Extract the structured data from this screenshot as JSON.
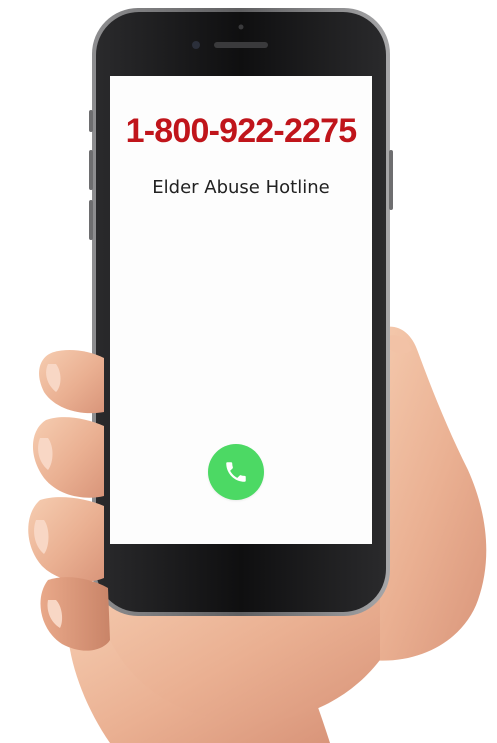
{
  "dialer": {
    "phone_number": "1-800-922-2275",
    "caption": "Elder Abuse Hotline",
    "call_icon": "phone-icon",
    "call_button_color": "#4cd964",
    "number_color": "#c0151b"
  }
}
